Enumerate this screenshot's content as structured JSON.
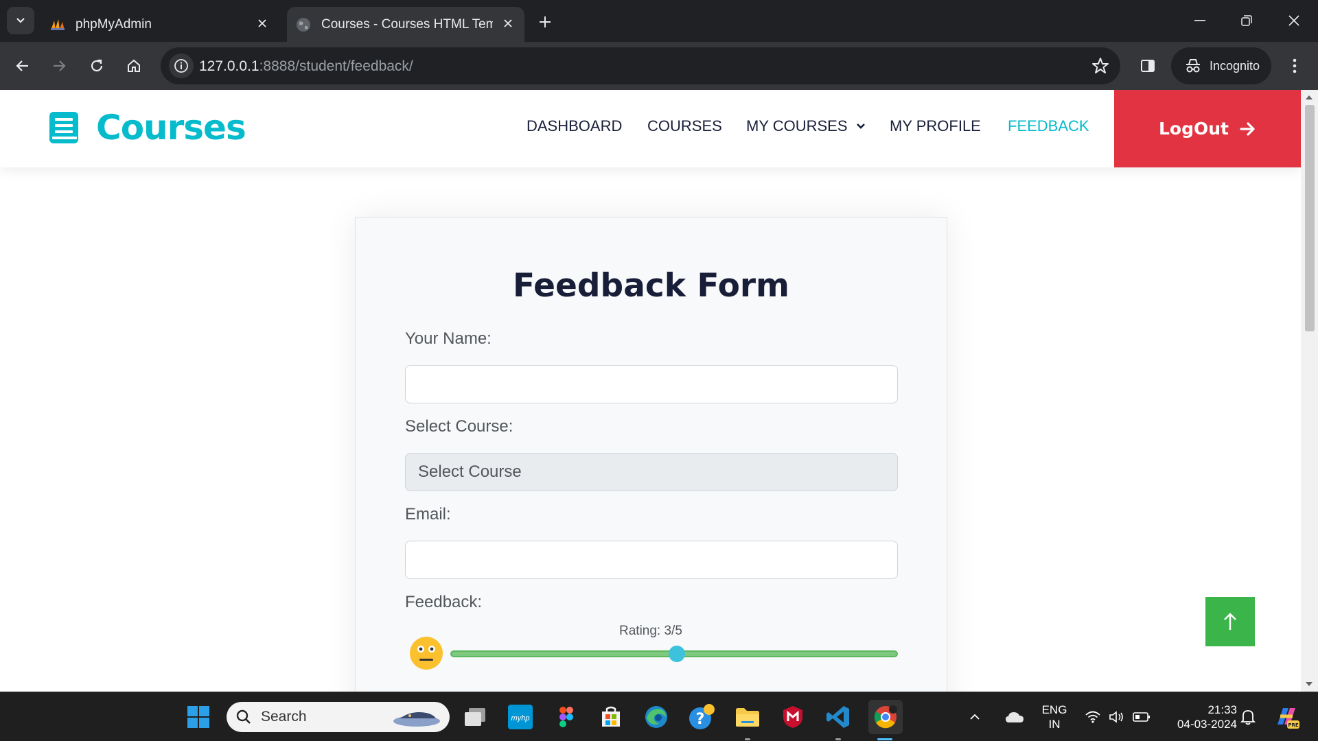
{
  "browser": {
    "tabs": [
      {
        "title": "phpMyAdmin",
        "active": false,
        "icon": "phpmyadmin-icon"
      },
      {
        "title": "Courses - Courses HTML Template",
        "active": true,
        "icon": "globe-icon"
      }
    ],
    "url_host": "127.0.0.1",
    "url_rest": ":8888/student/feedback/",
    "incognito_label": "Incognito"
  },
  "site": {
    "brand": "Courses",
    "nav": [
      {
        "label": "DASHBOARD"
      },
      {
        "label": "COURSES"
      },
      {
        "label": "MY COURSES"
      },
      {
        "label": "MY PROFILE"
      },
      {
        "label": "FEEDBACK"
      }
    ],
    "logout_label": "LogOut",
    "accent_color": "#06bbcc",
    "logout_color": "#e23342"
  },
  "form": {
    "title": "Feedback Form",
    "name_label": "Your Name:",
    "name_value": "",
    "course_label": "Select Course:",
    "course_selected": "Select Course",
    "email_label": "Email:",
    "email_value": "",
    "feedback_label": "Feedback:",
    "rating_text": "Rating: 3/5",
    "rating_value": 3,
    "rating_max": 5
  },
  "taskbar": {
    "search_placeholder": "Search",
    "lang_top": "ENG",
    "lang_bottom": "IN",
    "time": "21:33",
    "date": "04-03-2024"
  }
}
